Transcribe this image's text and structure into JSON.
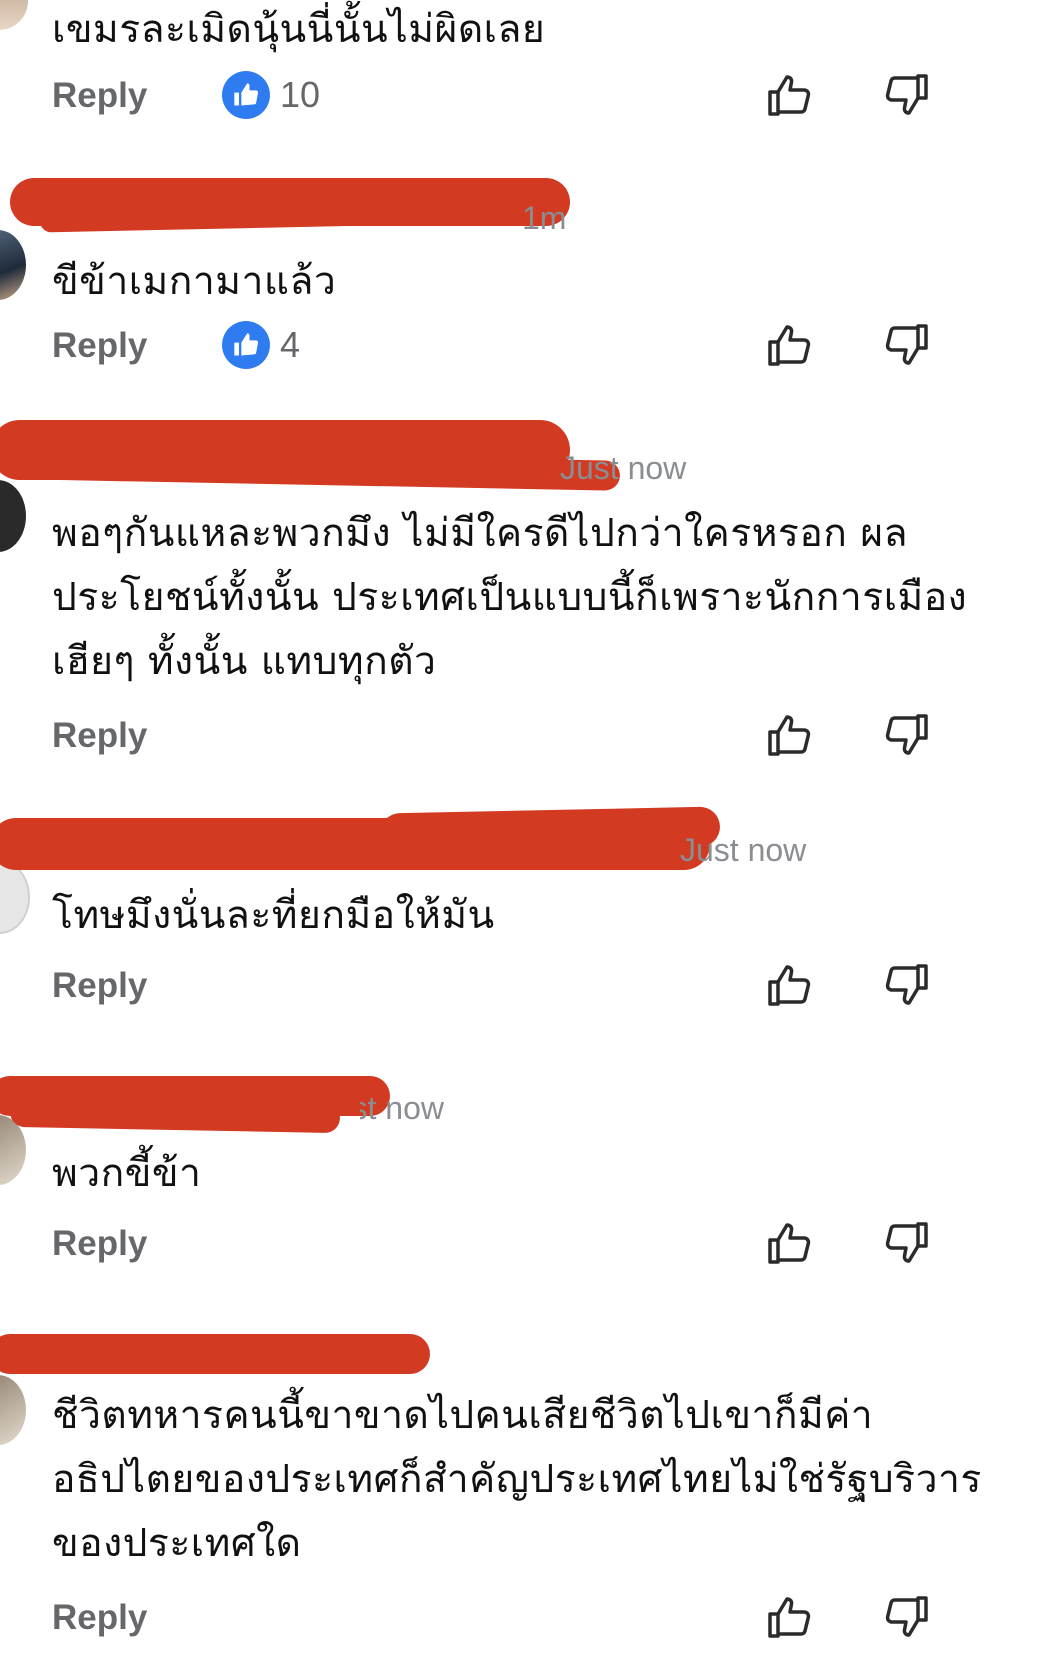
{
  "reply_label": "Reply",
  "colors": {
    "redaction": "#d23a22",
    "like_blue": "#2f7bf0",
    "muted": "#65676b"
  },
  "comments": [
    {
      "text": "เขมรละเมิดนุ้นนี่นั้นไม่ผิดเลย",
      "timestamp": "",
      "reactions": "10"
    },
    {
      "text": "ขีข้าเมกามาแล้ว",
      "timestamp": "1m",
      "reactions": "4"
    },
    {
      "text": "พอๆกันแหละพวกมึง ไม่มีใครดีไปกว่าใครหรอก ผลประโยชน์ทั้งนั้น ประเทศเป็นแบบนี้ก็เพราะนักการเมือง เฮียๆ ทั้งนั้น แทบทุกตัว",
      "timestamp": "Just now",
      "reactions": ""
    },
    {
      "text": "โทษมึงนั่นละที่ยกมือให้มัน",
      "timestamp": "Just now",
      "reactions": ""
    },
    {
      "text": "พวกขี้ข้า",
      "timestamp": "Just now",
      "reactions": ""
    },
    {
      "text": "ชีวิตทหารคนนี้ขาขาดไปคนเสียชีวิตไปเขาก็มีค่าอธิปไตยของประเทศก็สำคัญประเทศไทยไม่ใช่รัฐบริวารของประเทศใด",
      "timestamp": "",
      "reactions": ""
    }
  ],
  "icons": {
    "like_badge": "thumbs-up-icon",
    "like": "thumbs-up-outline-icon",
    "dislike": "thumbs-down-outline-icon"
  }
}
